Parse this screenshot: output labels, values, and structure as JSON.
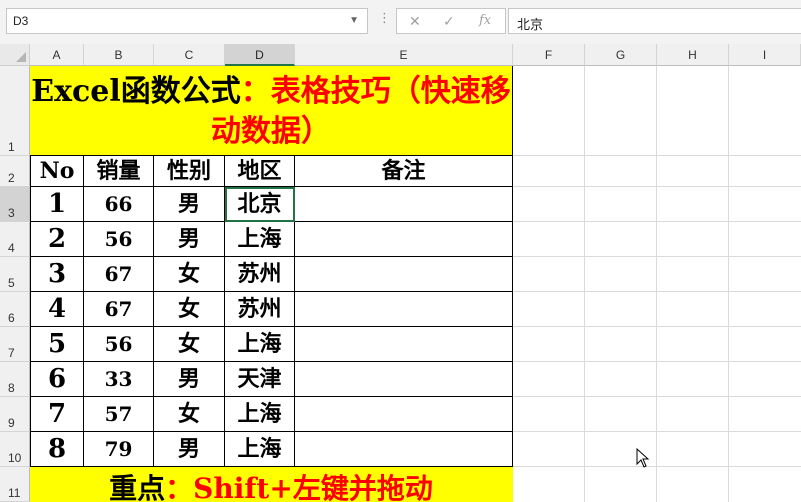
{
  "namebox": {
    "value": "D3"
  },
  "formula_bar": {
    "value": "北京"
  },
  "columns": [
    "A",
    "B",
    "C",
    "D",
    "E",
    "F",
    "G",
    "H",
    "I"
  ],
  "rows": [
    "1",
    "2",
    "3",
    "4",
    "5",
    "6",
    "7",
    "8",
    "9",
    "10",
    "11"
  ],
  "banner": {
    "title_black": "Excel函数公式",
    "title_red": "：表格技巧（快速移动数据）"
  },
  "table": {
    "headers": [
      "No",
      "销量",
      "性别",
      "地区",
      "备注"
    ],
    "rows": [
      {
        "no": "1",
        "sales": "66",
        "gender": "男",
        "region": "北京",
        "note": ""
      },
      {
        "no": "2",
        "sales": "56",
        "gender": "男",
        "region": "上海",
        "note": ""
      },
      {
        "no": "3",
        "sales": "67",
        "gender": "女",
        "region": "苏州",
        "note": ""
      },
      {
        "no": "4",
        "sales": "67",
        "gender": "女",
        "region": "苏州",
        "note": ""
      },
      {
        "no": "5",
        "sales": "56",
        "gender": "女",
        "region": "上海",
        "note": ""
      },
      {
        "no": "6",
        "sales": "33",
        "gender": "男",
        "region": "天津",
        "note": ""
      },
      {
        "no": "7",
        "sales": "57",
        "gender": "女",
        "region": "上海",
        "note": ""
      },
      {
        "no": "8",
        "sales": "79",
        "gender": "男",
        "region": "上海",
        "note": ""
      }
    ]
  },
  "footer": {
    "black": "重点",
    "red": "：Shift+左键并拖动"
  },
  "colors": {
    "highlight": "#ffff00",
    "accent_red": "#ff0000",
    "excel_green": "#217346"
  }
}
